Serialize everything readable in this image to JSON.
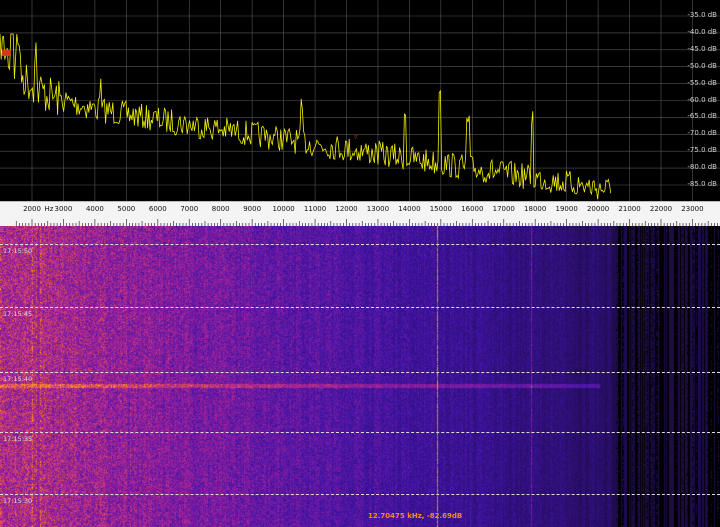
{
  "spectrum": {
    "db_labels": [
      "-35.0 dB",
      "-40.0 dB",
      "-45.0 dB",
      "-50.0 dB",
      "-55.0 dB",
      "-60.0 dB",
      "-65.0 dB",
      "-70.0 dB",
      "-75.0 dB",
      "-80.0 dB",
      "-85.0 dB"
    ],
    "trace_color": "#f2f000",
    "grid_color": "#555555",
    "marker_color": "#d43a1a"
  },
  "frequency_scale": {
    "labels": [
      "2000",
      "Hz",
      "3000",
      "4000",
      "5000",
      "6000",
      "7000",
      "8000",
      "9000",
      "10000",
      "11000",
      "12000",
      "13000",
      "14000",
      "15000",
      "16000",
      "17000",
      "18000",
      "19000",
      "20000",
      "21000",
      "22000",
      "23000"
    ]
  },
  "waterfall": {
    "time_labels": [
      "17:15:50",
      "17:15:45",
      "17:15:40",
      "17:15:35",
      "17:15:30"
    ],
    "cursor_readout": "12.70475 kHz, -82.69dB"
  }
}
